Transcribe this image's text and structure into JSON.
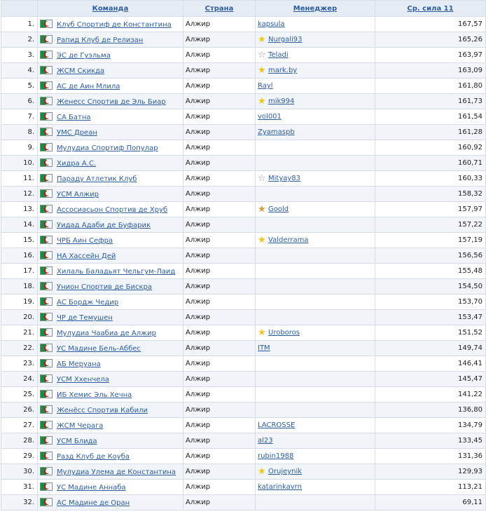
{
  "headers": {
    "team": "Команда",
    "country": "Страна",
    "manager": "Менеджер",
    "strength": "Ср. сила 11"
  },
  "colors": {
    "link": "#2c5d9c",
    "row_alt": "#f1f4f9",
    "header_bg": "#e6ecf4"
  },
  "rows": [
    {
      "rank": "1.",
      "team": "Клуб Спортиф де Константина",
      "country": "Алжир",
      "manager": "kapsula",
      "star": "",
      "strength": "167,57"
    },
    {
      "rank": "2.",
      "team": "Рапид Клуб де Релизан",
      "country": "Алжир",
      "manager": "Nurgali93",
      "star": "gold",
      "strength": "165,26"
    },
    {
      "rank": "3.",
      "team": "ЭС де Гуэльма",
      "country": "Алжир",
      "manager": "Teladi",
      "star": "silver",
      "strength": "163,97"
    },
    {
      "rank": "4.",
      "team": "ЖСМ Скикда",
      "country": "Алжир",
      "manager": "mark.by",
      "star": "gold",
      "strength": "163,09"
    },
    {
      "rank": "5.",
      "team": "АС де Аин Млила",
      "country": "Алжир",
      "manager": "Rayl",
      "star": "",
      "strength": "161,80"
    },
    {
      "rank": "6.",
      "team": "Женесс Спортив де Эль Биар",
      "country": "Алжир",
      "manager": "mik994",
      "star": "gold",
      "strength": "161,73"
    },
    {
      "rank": "7.",
      "team": "СА Батна",
      "country": "Алжир",
      "manager": "vol001",
      "star": "",
      "strength": "161,54"
    },
    {
      "rank": "8.",
      "team": "УМС Дреан",
      "country": "Алжир",
      "manager": "Zyamaspb",
      "star": "",
      "strength": "161,28"
    },
    {
      "rank": "9.",
      "team": "Мулудиа Спортиф Популар",
      "country": "Алжир",
      "manager": "",
      "star": "",
      "strength": "160,92"
    },
    {
      "rank": "10.",
      "team": "Хидра А.С.",
      "country": "Алжир",
      "manager": "",
      "star": "",
      "strength": "160,71"
    },
    {
      "rank": "11.",
      "team": "Параду Атлетик Клуб",
      "country": "Алжир",
      "manager": "Mityay83",
      "star": "silver",
      "strength": "160,33"
    },
    {
      "rank": "12.",
      "team": "УСМ Алжир",
      "country": "Алжир",
      "manager": "",
      "star": "",
      "strength": "158,32"
    },
    {
      "rank": "13.",
      "team": "Ассосиасьон Спортив де Хруб",
      "country": "Алжир",
      "manager": "Goold",
      "star": "bronze",
      "strength": "157,97"
    },
    {
      "rank": "14.",
      "team": "Уидад Адаби де Буфарик",
      "country": "Алжир",
      "manager": "",
      "star": "",
      "strength": "157,22"
    },
    {
      "rank": "15.",
      "team": "ЧРБ Аин Сефра",
      "country": "Алжир",
      "manager": "Valderrama",
      "star": "gold",
      "strength": "157,19"
    },
    {
      "rank": "16.",
      "team": "НА Хассейн Дей",
      "country": "Алжир",
      "manager": "",
      "star": "",
      "strength": "156,56"
    },
    {
      "rank": "17.",
      "team": "Хилаль Баладьят Чельгум-Лаид",
      "country": "Алжир",
      "manager": "",
      "star": "",
      "strength": "155,48"
    },
    {
      "rank": "18.",
      "team": "Унион Спортив де Бискра",
      "country": "Алжир",
      "manager": "",
      "star": "",
      "strength": "154,50"
    },
    {
      "rank": "19.",
      "team": "АС Бордж Чедир",
      "country": "Алжир",
      "manager": "",
      "star": "",
      "strength": "153,70"
    },
    {
      "rank": "20.",
      "team": "ЧР де Темушен",
      "country": "Алжир",
      "manager": "",
      "star": "",
      "strength": "153,47"
    },
    {
      "rank": "21.",
      "team": "Мулудиа Чаабиа де Алжир",
      "country": "Алжир",
      "manager": "Uroboros",
      "star": "gold",
      "strength": "151,52"
    },
    {
      "rank": "22.",
      "team": "УС Мадине Бель-Аббес",
      "country": "Алжир",
      "manager": "ITM",
      "star": "",
      "strength": "149,74"
    },
    {
      "rank": "23.",
      "team": "АБ Меруана",
      "country": "Алжир",
      "manager": "",
      "star": "",
      "strength": "146,41"
    },
    {
      "rank": "24.",
      "team": "УСМ Ххенчела",
      "country": "Алжир",
      "manager": "",
      "star": "",
      "strength": "145,47"
    },
    {
      "rank": "25.",
      "team": "ИБ Хемис Эль Хечна",
      "country": "Алжир",
      "manager": "",
      "star": "",
      "strength": "141,22"
    },
    {
      "rank": "26.",
      "team": "Женёсс Спортив Кабили",
      "country": "Алжир",
      "manager": "",
      "star": "",
      "strength": "136,80"
    },
    {
      "rank": "27.",
      "team": "ЖСМ Черага",
      "country": "Алжир",
      "manager": "LACROSSE",
      "star": "",
      "strength": "134,79"
    },
    {
      "rank": "28.",
      "team": "УСМ Блида",
      "country": "Алжир",
      "manager": "al23",
      "star": "",
      "strength": "133,45"
    },
    {
      "rank": "29.",
      "team": "Разд Клуб де Коуба",
      "country": "Алжир",
      "manager": "rubin1988",
      "star": "",
      "strength": "131,36"
    },
    {
      "rank": "30.",
      "team": "Мулудиа Улема де Константина",
      "country": "Алжир",
      "manager": "Orujeynik",
      "star": "gold",
      "strength": "129,93"
    },
    {
      "rank": "31.",
      "team": "УС Мадине Аннаба",
      "country": "Алжир",
      "manager": "katarinkavrn",
      "star": "",
      "strength": "113,21"
    },
    {
      "rank": "32.",
      "team": "АС Мадине де Оран",
      "country": "Алжир",
      "manager": "",
      "star": "",
      "strength": "69,11"
    }
  ]
}
